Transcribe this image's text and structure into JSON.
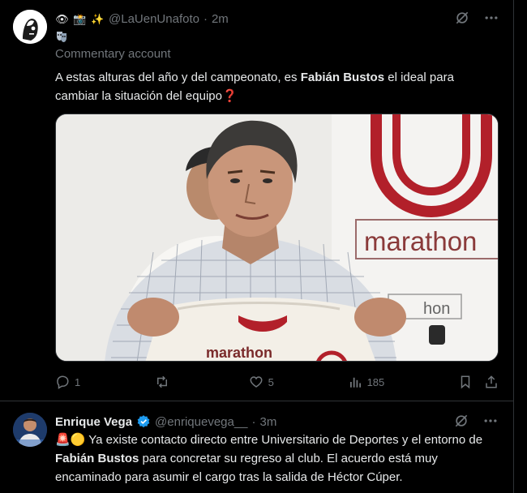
{
  "tweet1": {
    "handle": "@LaUenUnafoto",
    "separator": "·",
    "time": "2m",
    "header_emojis": [
      "👁",
      "📸",
      "✨"
    ],
    "account_label": "Commentary account",
    "text_pre": "A estas alturas del año y del campeonato, es ",
    "text_bold": "Fabián Bustos",
    "text_post": " el ideal para cambiar la situación del equipo",
    "text_emoji": "❓",
    "photo_text_jersey": "marathon",
    "photo_text_banner": "marathon",
    "photo_text_banner2": "hon",
    "stats": {
      "replies": "1",
      "retweets": "",
      "likes": "5",
      "views": "185"
    }
  },
  "tweet2": {
    "name": "Enrique Vega",
    "handle": "@enriquevega__",
    "separator": "·",
    "time": "3m",
    "text_emojis": "🚨🟡",
    "text_pre": " Ya existe contacto directo entre Universitario de Deportes y el entorno de ",
    "text_bold": "Fabián Bustos",
    "text_post": " para concretar su regreso al club. El acuerdo está muy encaminado para asumir el cargo tras la salida de Héctor Cúper."
  },
  "colors": {
    "background": "#000000",
    "text": "#e7e9ea",
    "muted": "#71767b",
    "border": "#2f3336",
    "verified": "#1d9bf0",
    "brand_red": "#b2202a"
  }
}
